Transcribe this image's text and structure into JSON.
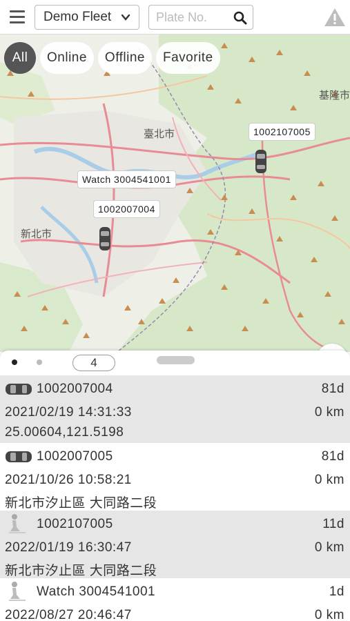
{
  "header": {
    "fleet_label": "Demo Fleet",
    "plate_placeholder": "Plate No."
  },
  "filters": {
    "all": "All",
    "online": "Online",
    "offline": "Offline",
    "favorite": "Favorite"
  },
  "map": {
    "labels": [
      "1002107005",
      "Watch 3004541001",
      "1002007004"
    ],
    "places": [
      "新北市",
      "臺北市",
      "基隆市"
    ]
  },
  "sheet": {
    "count": "4"
  },
  "vehicles": [
    {
      "icon": "car-icon",
      "name": "1002007004",
      "age": "81d",
      "time": "2021/02/19 14:31:33",
      "distance": "0 km",
      "location": "25.00604,121.5198"
    },
    {
      "icon": "car-icon",
      "name": "1002007005",
      "age": "81d",
      "time": "2021/10/26 10:58:21",
      "distance": "0 km",
      "location": "新北市汐止區 大同路二段"
    },
    {
      "icon": "person-icon",
      "name": "1002107005",
      "age": "11d",
      "time": "2022/01/19 16:30:47",
      "distance": "0 km",
      "location": "新北市汐止區 大同路二段"
    },
    {
      "icon": "person-icon",
      "name": "Watch 3004541001",
      "age": "1d",
      "time": "2022/08/27 20:46:47",
      "distance": "0 km",
      "location": ""
    }
  ]
}
